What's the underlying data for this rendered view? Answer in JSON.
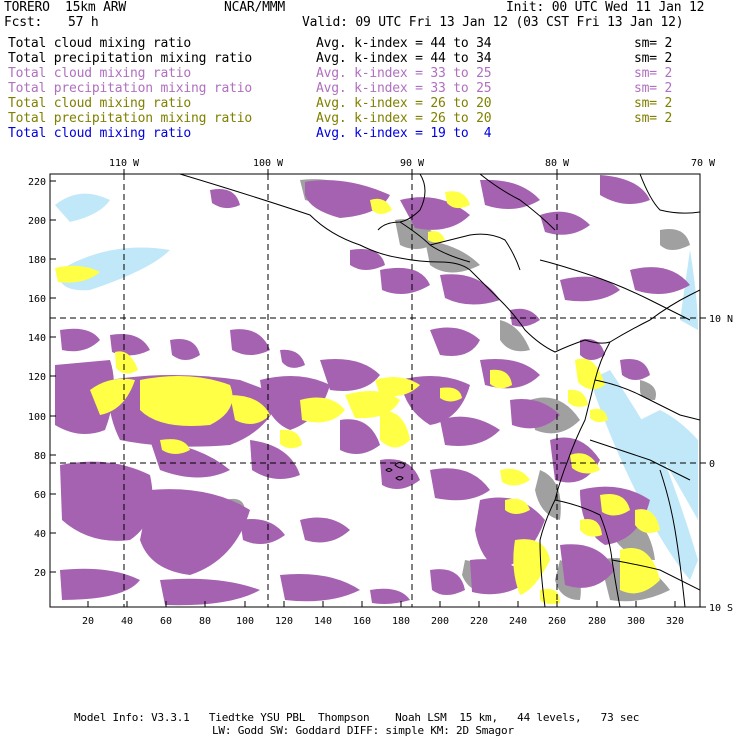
{
  "header": {
    "model": "TORERO  15km ARW",
    "org": "NCAR/MMM",
    "init": "Init: 00 UTC Wed 11 Jan 12",
    "fcst_label": "Fcst:",
    "fcst_value": "57 h",
    "valid": "Valid: 09 UTC Fri 13 Jan 12 (03 CST Fri 13 Jan 12)"
  },
  "legend": [
    {
      "field": "Total cloud mixing ratio",
      "range": "Avg. k-index = 44 to 34",
      "sm": "sm= 2",
      "color": "#000000"
    },
    {
      "field": "Total precipitation mixing ratio",
      "range": "Avg. k-index = 44 to 34",
      "sm": "sm= 2",
      "color": "#000000"
    },
    {
      "field": "Total cloud mixing ratio",
      "range": "Avg. k-index = 33 to 25",
      "sm": "sm= 2",
      "color": "#b070c0"
    },
    {
      "field": "Total precipitation mixing ratio",
      "range": "Avg. k-index = 33 to 25",
      "sm": "sm= 2",
      "color": "#b070c0"
    },
    {
      "field": "Total cloud mixing ratio",
      "range": "Avg. k-index = 26 to 20",
      "sm": "sm= 2",
      "color": "#808000"
    },
    {
      "field": "Total precipitation mixing ratio",
      "range": "Avg. k-index = 26 to 20",
      "sm": "sm= 2",
      "color": "#808000"
    },
    {
      "field": "Total cloud mixing ratio",
      "range": "Avg. k-index = 19 to  4",
      "sm": "",
      "color": "#0000e0"
    }
  ],
  "colors": {
    "purple": "#a562b0",
    "yellow": "#ffff46",
    "gray": "#a0a0a0",
    "lightblue": "#c0e8f8",
    "grid": "#000000"
  },
  "map": {
    "top_lon_labels": [
      "110 W",
      "100 W",
      "90 W",
      "80 W",
      "70 W"
    ],
    "right_lat_labels": [
      "10 N",
      "0",
      "10 S"
    ],
    "left_ticks": [
      "220",
      "200",
      "180",
      "160",
      "140",
      "120",
      "100",
      "80",
      "60",
      "40",
      "20"
    ],
    "bottom_ticks": [
      "20",
      "40",
      "60",
      "80",
      "100",
      "120",
      "140",
      "160",
      "180",
      "200",
      "220",
      "240",
      "260",
      "280",
      "300",
      "320"
    ]
  },
  "footer": {
    "line1": "Model Info: V3.3.1   Tiedtke YSU PBL  Thompson    Noah LSM  15 km,   44 levels,   73 sec",
    "line2": "LW: Godd SW: Goddard DIFF: simple KM: 2D Smagor"
  }
}
